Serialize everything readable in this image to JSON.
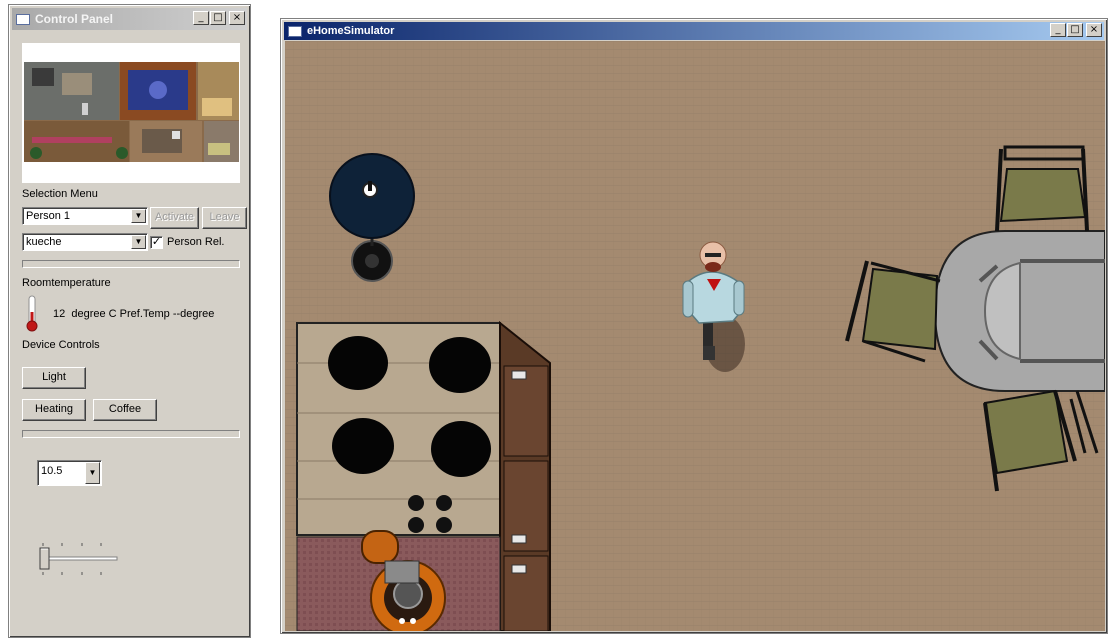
{
  "control_panel": {
    "title": "Control Panel",
    "selection_menu_label": "Selection Menu",
    "person_select": "Person 1",
    "room_select": "kueche",
    "activate_label": "Activate",
    "leave_label": "Leave",
    "person_rel_label": "Person Rel.",
    "person_rel_checked": "✓",
    "roomtemp_label": "Roomtemperature",
    "temperature_text": "12  degree C Pref.Temp --degree",
    "device_controls_label": "Device Controls",
    "light_label": "Light",
    "heating_label": "Heating",
    "coffee_label": "Coffee",
    "value_select": "10.5"
  },
  "simulator": {
    "title": "eHomeSimulator"
  },
  "window_buttons": {
    "minimize": "_",
    "maximize": "□",
    "close": "×"
  },
  "colors": {
    "floor": "#a3886e",
    "panel_bg": "#d4d0c8",
    "title_active": "#0a246a",
    "title_inactive": "#a9a9a9"
  }
}
